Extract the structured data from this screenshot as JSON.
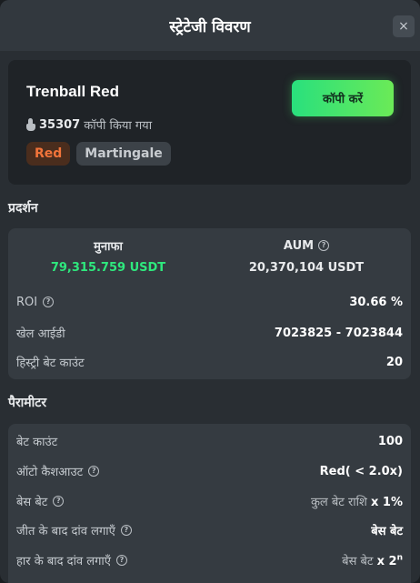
{
  "header": {
    "title": "स्ट्रेटेजी विवरण",
    "close_label": "×"
  },
  "strategy": {
    "name": "Trenball Red",
    "copy_count": "35307",
    "copy_suffix": "कॉपी किया गया",
    "tags": [
      "Red",
      "Martingale"
    ],
    "copy_button": "कॉपी करें"
  },
  "performance": {
    "title": "प्रदर्शन",
    "profit_label": "मुनाफा",
    "profit_value": "79,315.759 USDT",
    "aum_label": "AUM",
    "aum_value": "20,370,104 USDT",
    "roi_label": "ROI",
    "roi_value": "30.66 %",
    "game_id_label": "खेल आईडी",
    "game_id_value": "7023825 - 7023844",
    "history_label": "हिस्ट्री बेट काउंट",
    "history_value": "20"
  },
  "parameters": {
    "title": "पैरामीटर",
    "bet_count_label": "बेट काउंट",
    "bet_count_value": "100",
    "auto_cashout_label": "ऑटो कैशआउट",
    "auto_cashout_value": "Red( < 2.0x)",
    "base_bet_label": "बेस बेट",
    "base_bet_value_prefix": "कुल बेट राशि",
    "base_bet_value_suffix": "x 1%",
    "on_win_label": "जीत के बाद दांव लगाएँ",
    "on_win_value": "बेस बेट",
    "on_loss_label": "हार के बाद दांव लगाएँ",
    "on_loss_value_prefix": "बेस बेट",
    "on_loss_value_suffix": "x 2",
    "on_loss_value_sup": "n"
  },
  "colors": {
    "accent": "#2ee87d",
    "tag_red": "#f2743a",
    "panel": "#353b41",
    "background": "#292e33"
  },
  "icons": {
    "close": "close-icon",
    "hand": "hand-icon",
    "info": "info-icon"
  }
}
